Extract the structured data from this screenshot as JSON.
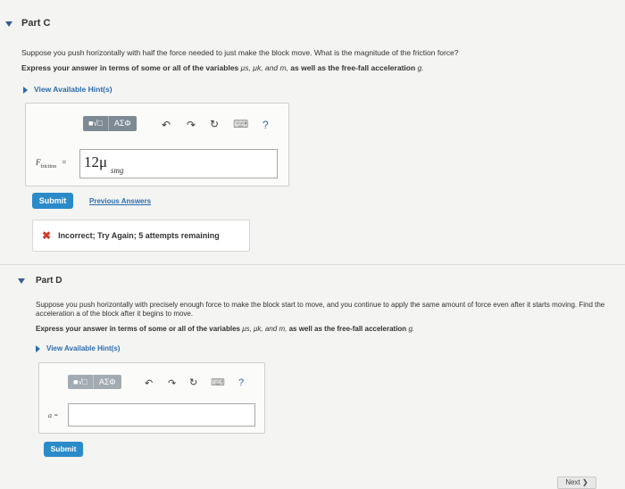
{
  "partC": {
    "title": "Part C",
    "question": "Suppose you push horizontally with half the force needed to just make the block move. What is the magnitude of the friction force?",
    "instruction_prefix": "Express your answer in terms of some or all of the variables",
    "instruction_vars": "μs, μk, and m,",
    "instruction_suffix": "as well as the free-fall acceleration",
    "instruction_g": "g.",
    "hint_label": "View Available Hint(s)",
    "toolbar": {
      "templates": "■√□",
      "symbols": "ΑΣΦ",
      "undo": "↶",
      "redo": "↷",
      "reset": "↻",
      "keyboard": "⌨",
      "help": "?"
    },
    "answer_label_main": "F",
    "answer_label_sub": "friction",
    "answer_eq": "=",
    "answer_value": "12μ",
    "answer_sub": "smg",
    "submit_label": "Submit",
    "previous_answers_label": "Previous Answers",
    "feedback_icon": "✖",
    "feedback_text": "Incorrect; Try Again; 5 attempts remaining"
  },
  "partD": {
    "title": "Part D",
    "question": "Suppose you push horizontally with precisely enough force to make the block start to move, and you continue to apply the same amount of force even after it starts moving. Find the acceleration a of the block after it begins to move.",
    "instruction_prefix": "Express your answer in terms of some or all of the variables",
    "instruction_vars": "μs, μk, and m,",
    "instruction_suffix": "as well as the free-fall acceleration",
    "instruction_g": "g.",
    "hint_label": "View Available Hint(s)",
    "toolbar": {
      "templates": "■√□",
      "symbols": "ΑΣΦ",
      "undo": "↶",
      "redo": "↷",
      "reset": "↻",
      "keyboard": "⌨",
      "help": "?"
    },
    "answer_label": "a =",
    "answer_value": "",
    "submit_label": "Submit"
  },
  "footer": {
    "next_label": "Next ❯"
  }
}
